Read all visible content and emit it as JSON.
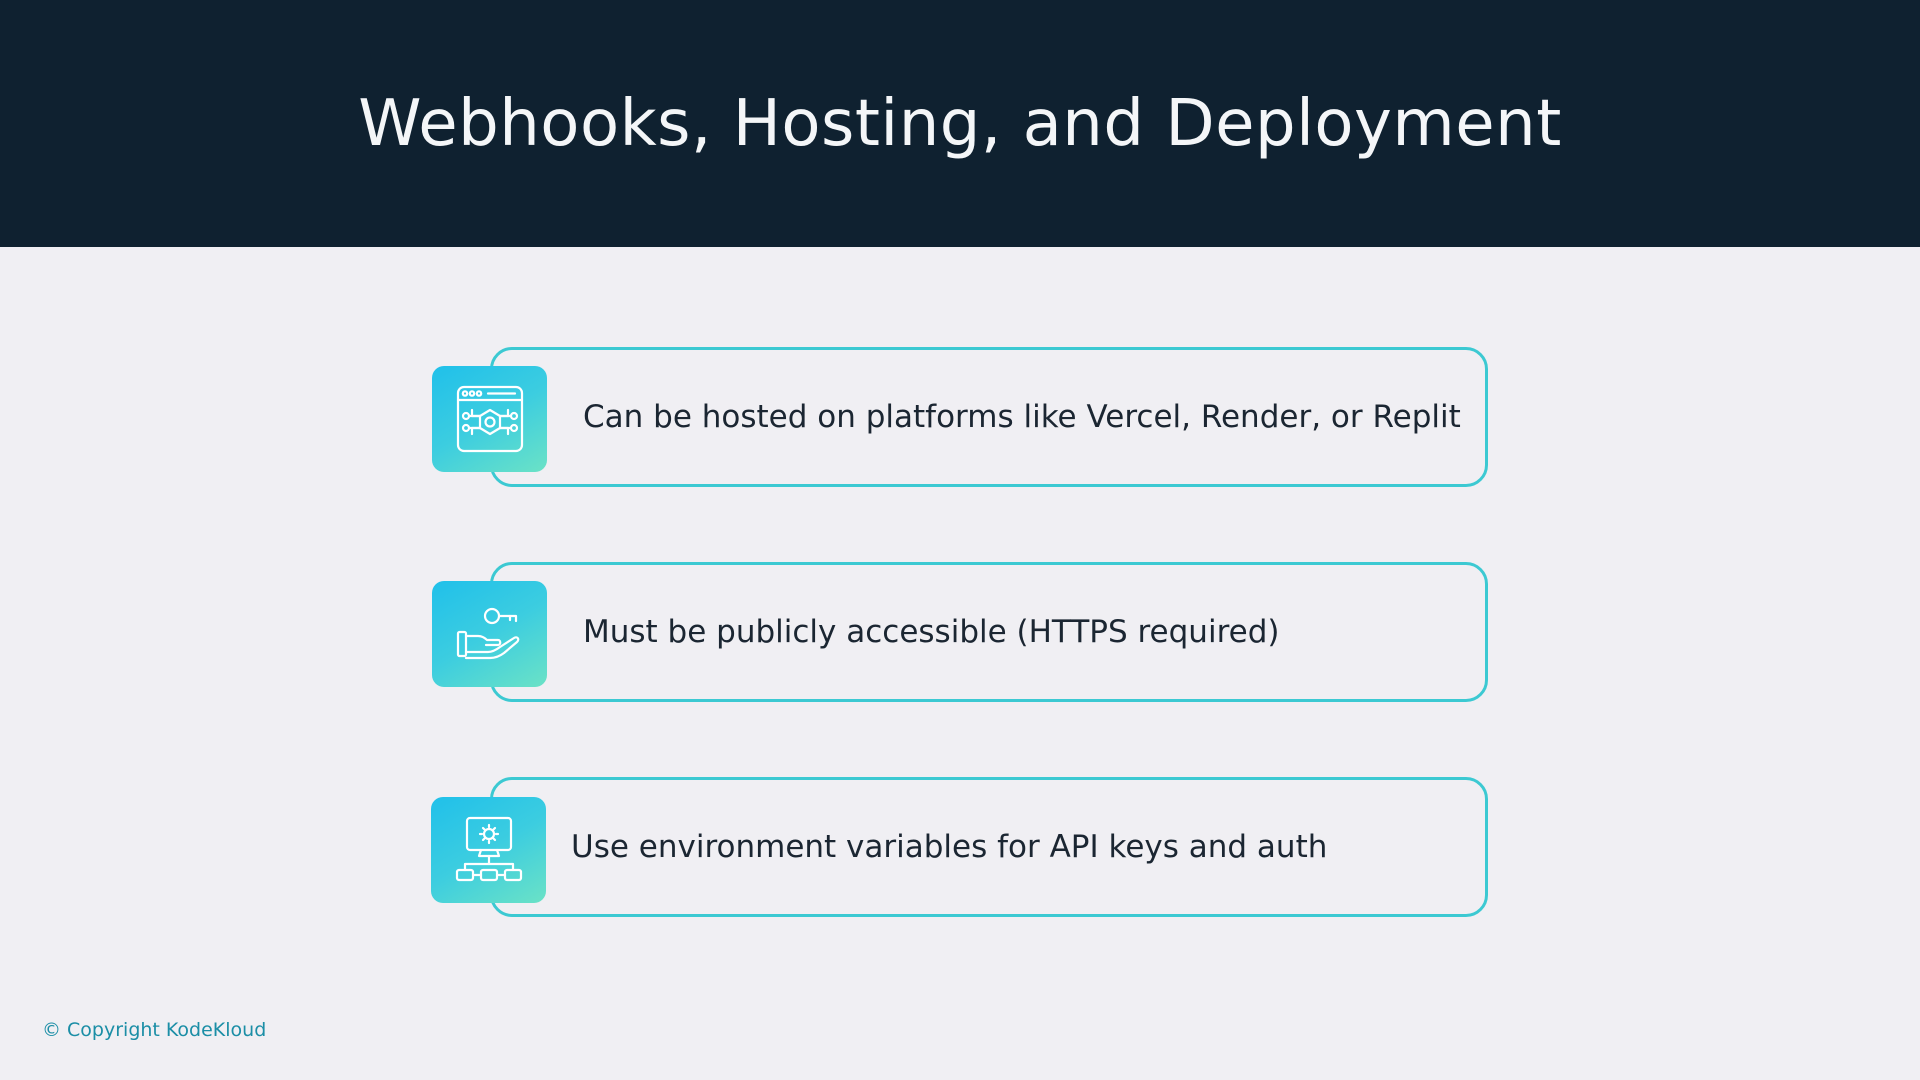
{
  "header": {
    "title": "Webhooks, Hosting, and Deployment"
  },
  "items": [
    {
      "icon": "browser-settings-icon",
      "text": "Can be hosted on platforms like Vercel, Render, or Replit"
    },
    {
      "icon": "hand-key-icon",
      "text": "Must be publicly accessible (HTTPS required)"
    },
    {
      "icon": "monitor-network-icon",
      "text": "Use environment variables for API keys and auth"
    }
  ],
  "footer": {
    "copyright": "© Copyright KodeKloud"
  },
  "colors": {
    "header_bg": "#0f2130",
    "page_bg": "#f0eff3",
    "accent_border": "#3cc9d2",
    "icon_gradient_start": "#20c0ea",
    "icon_gradient_end": "#6be2c6",
    "footer_text": "#1b8ea6"
  }
}
